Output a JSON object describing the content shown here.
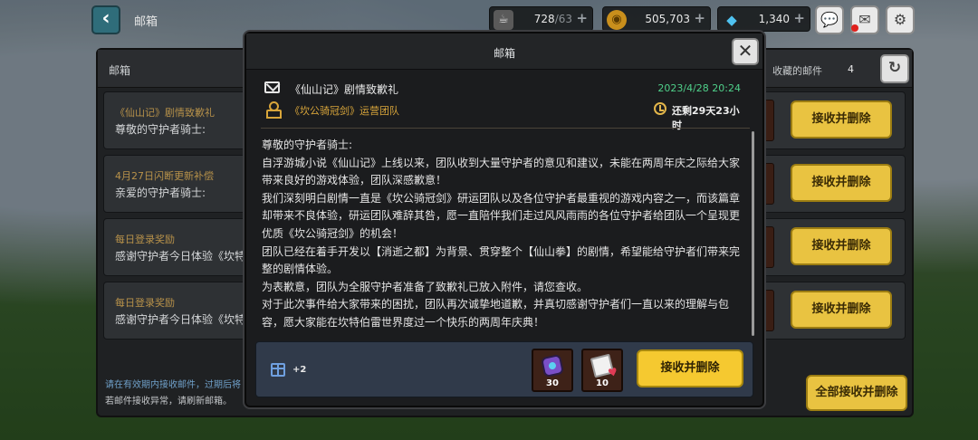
{
  "topbar": {
    "title": "邮箱",
    "stamina": {
      "current": "728",
      "max": "/63"
    },
    "gold": "505,703",
    "gems": "1,340"
  },
  "mailbox": {
    "title": "邮箱",
    "favorites_label": "收藏的邮件",
    "favorites_count": "4",
    "mails": [
      {
        "subject": "《仙山记》剧情致歉礼",
        "preview": "尊敬的守护者骑士:"
      },
      {
        "subject": "4月27日闪断更新补偿",
        "preview": "亲爱的守护者骑士:"
      },
      {
        "subject": "每日登录奖励",
        "preview": "感谢守护者今日体验《坎特伯"
      },
      {
        "subject": "每日登录奖励",
        "preview": "感谢守护者今日体验《坎特伯"
      }
    ],
    "row_button_label": "接收并删除",
    "notice_line1": "请在有效期内接收邮件，过期后将",
    "notice_line2": "若邮件接收异常，请刷新邮箱。",
    "claim_all_label": "全部接收并删除"
  },
  "modal": {
    "title": "邮箱",
    "subject": "《仙山记》剧情致歉礼",
    "date": "2023/4/28 20:24",
    "sender": "《坎公骑冠剑》运营团队",
    "remaining": "还剩29天23小时",
    "body": [
      "尊敬的守护者骑士:",
      "自浮游城小说《仙山记》上线以来，团队收到大量守护者的意见和建议，未能在两周年庆之际给大家带来良好的游戏体验，团队深感歉意！",
      "我们深刻明白剧情一直是《坎公骑冠剑》研运团队以及各位守护者最重视的游戏内容之一，而该篇章却带来不良体验，研运团队难辞其咎，愿一直陪伴我们走过风风雨雨的各位守护者给团队一个呈现更优质《坎公骑冠剑》的机会！",
      "团队已经在着手开发以【消逝之都】为背景、贯穿整个【仙山拳】的剧情，希望能给守护者们带来完整的剧情体验。",
      "为表歉意，团队为全服守护者准备了致歉礼已放入附件，请您查收。",
      "对于此次事件给大家带来的困扰，团队再次诚挚地道歉，并真切感谢守护者们一直以来的理解与包容，愿大家能在坎特伯雷世界度过一个快乐的两周年庆典！"
    ],
    "extra_attachments": "+2",
    "attachments": [
      {
        "icon": "purple-bag-icon",
        "qty": "30"
      },
      {
        "icon": "letter-heart-icon",
        "qty": "10"
      }
    ],
    "claim_label": "接收并删除"
  }
}
